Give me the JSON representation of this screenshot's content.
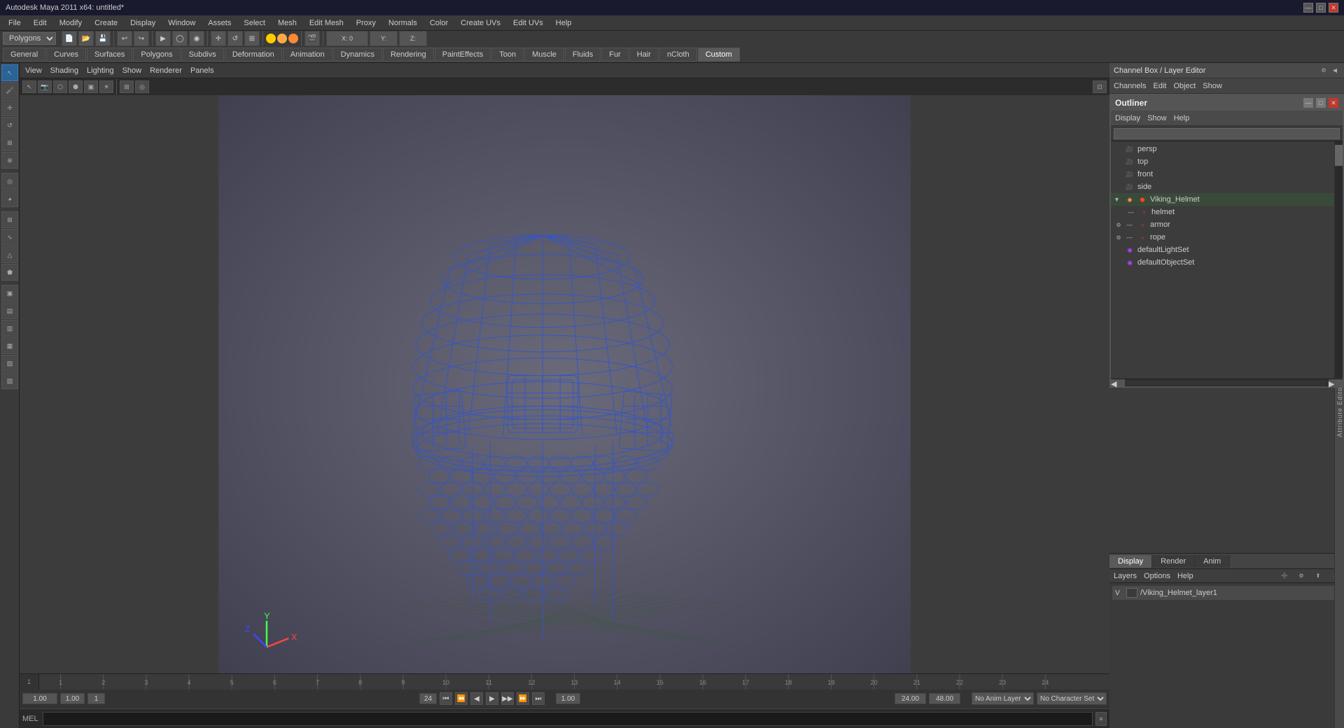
{
  "app": {
    "title": "Autodesk Maya 2011 x64: untitled*"
  },
  "titlebar": {
    "title": "Autodesk Maya 2011 x64: untitled*",
    "minimize": "—",
    "maximize": "□",
    "close": "✕"
  },
  "menubar": {
    "items": [
      "File",
      "Edit",
      "Modify",
      "Create",
      "Display",
      "Window",
      "Assets",
      "Select",
      "Mesh",
      "Edit Mesh",
      "Proxy",
      "Normals",
      "Color",
      "Create UVs",
      "Edit UVs",
      "Help"
    ]
  },
  "mode_selector": {
    "current": "Polygons"
  },
  "tabs": {
    "items": [
      "General",
      "Curves",
      "Surfaces",
      "Polygons",
      "Subdivs",
      "Deformation",
      "Animation",
      "Dynamics",
      "Rendering",
      "PaintEffects",
      "Toon",
      "Muscle",
      "Fluids",
      "Fur",
      "Hair",
      "nCloth",
      "Custom"
    ],
    "active": "Custom"
  },
  "viewport": {
    "menu_items": [
      "View",
      "Shading",
      "Lighting",
      "Show",
      "Renderer",
      "Panels"
    ],
    "lighting_menu": "Lighting"
  },
  "outliner": {
    "title": "Outliner",
    "menu_items": [
      "Display",
      "Show",
      "Help"
    ],
    "items": [
      {
        "id": "persp",
        "label": "persp",
        "type": "camera",
        "indent": 0
      },
      {
        "id": "top",
        "label": "top",
        "type": "camera",
        "indent": 0
      },
      {
        "id": "front",
        "label": "front",
        "type": "camera",
        "indent": 0
      },
      {
        "id": "side",
        "label": "side",
        "type": "camera",
        "indent": 0
      },
      {
        "id": "viking_helmet",
        "label": "Viking_Helmet",
        "type": "group",
        "indent": 0
      },
      {
        "id": "helmet",
        "label": "helmet",
        "type": "mesh",
        "indent": 1
      },
      {
        "id": "armor",
        "label": "armor",
        "type": "mesh",
        "indent": 1
      },
      {
        "id": "rope",
        "label": "rope",
        "type": "mesh",
        "indent": 1
      },
      {
        "id": "defaultLightSet",
        "label": "defaultLightSet",
        "type": "set",
        "indent": 0
      },
      {
        "id": "defaultObjectSet",
        "label": "defaultObjectSet",
        "type": "set",
        "indent": 0
      }
    ]
  },
  "channel_box": {
    "title": "Channel Box / Layer Editor",
    "menu_items": [
      "Channels",
      "Edit",
      "Object",
      "Show"
    ]
  },
  "display_panel": {
    "tabs": [
      "Display",
      "Render",
      "Anim"
    ],
    "active_tab": "Display",
    "sub_menu": [
      "Layers",
      "Options",
      "Help"
    ],
    "layers": [
      {
        "visible": "V",
        "name": "/Viking_Helmet_layer1"
      }
    ]
  },
  "timeline": {
    "start": "1.00",
    "end": "24",
    "current_time": "1.00",
    "range_start": "1.00",
    "range_end": "1",
    "playback_start": "24.00",
    "playback_end": "48.00",
    "anim_layer": "No Anim Layer",
    "character": "No Character Set",
    "ticks": [
      1,
      2,
      3,
      4,
      5,
      6,
      7,
      8,
      9,
      10,
      11,
      12,
      13,
      14,
      15,
      16,
      17,
      18,
      19,
      20,
      21,
      22,
      23,
      24
    ]
  },
  "mel": {
    "label": "MEL"
  },
  "status_bar": {
    "char_set": "Character Set"
  }
}
